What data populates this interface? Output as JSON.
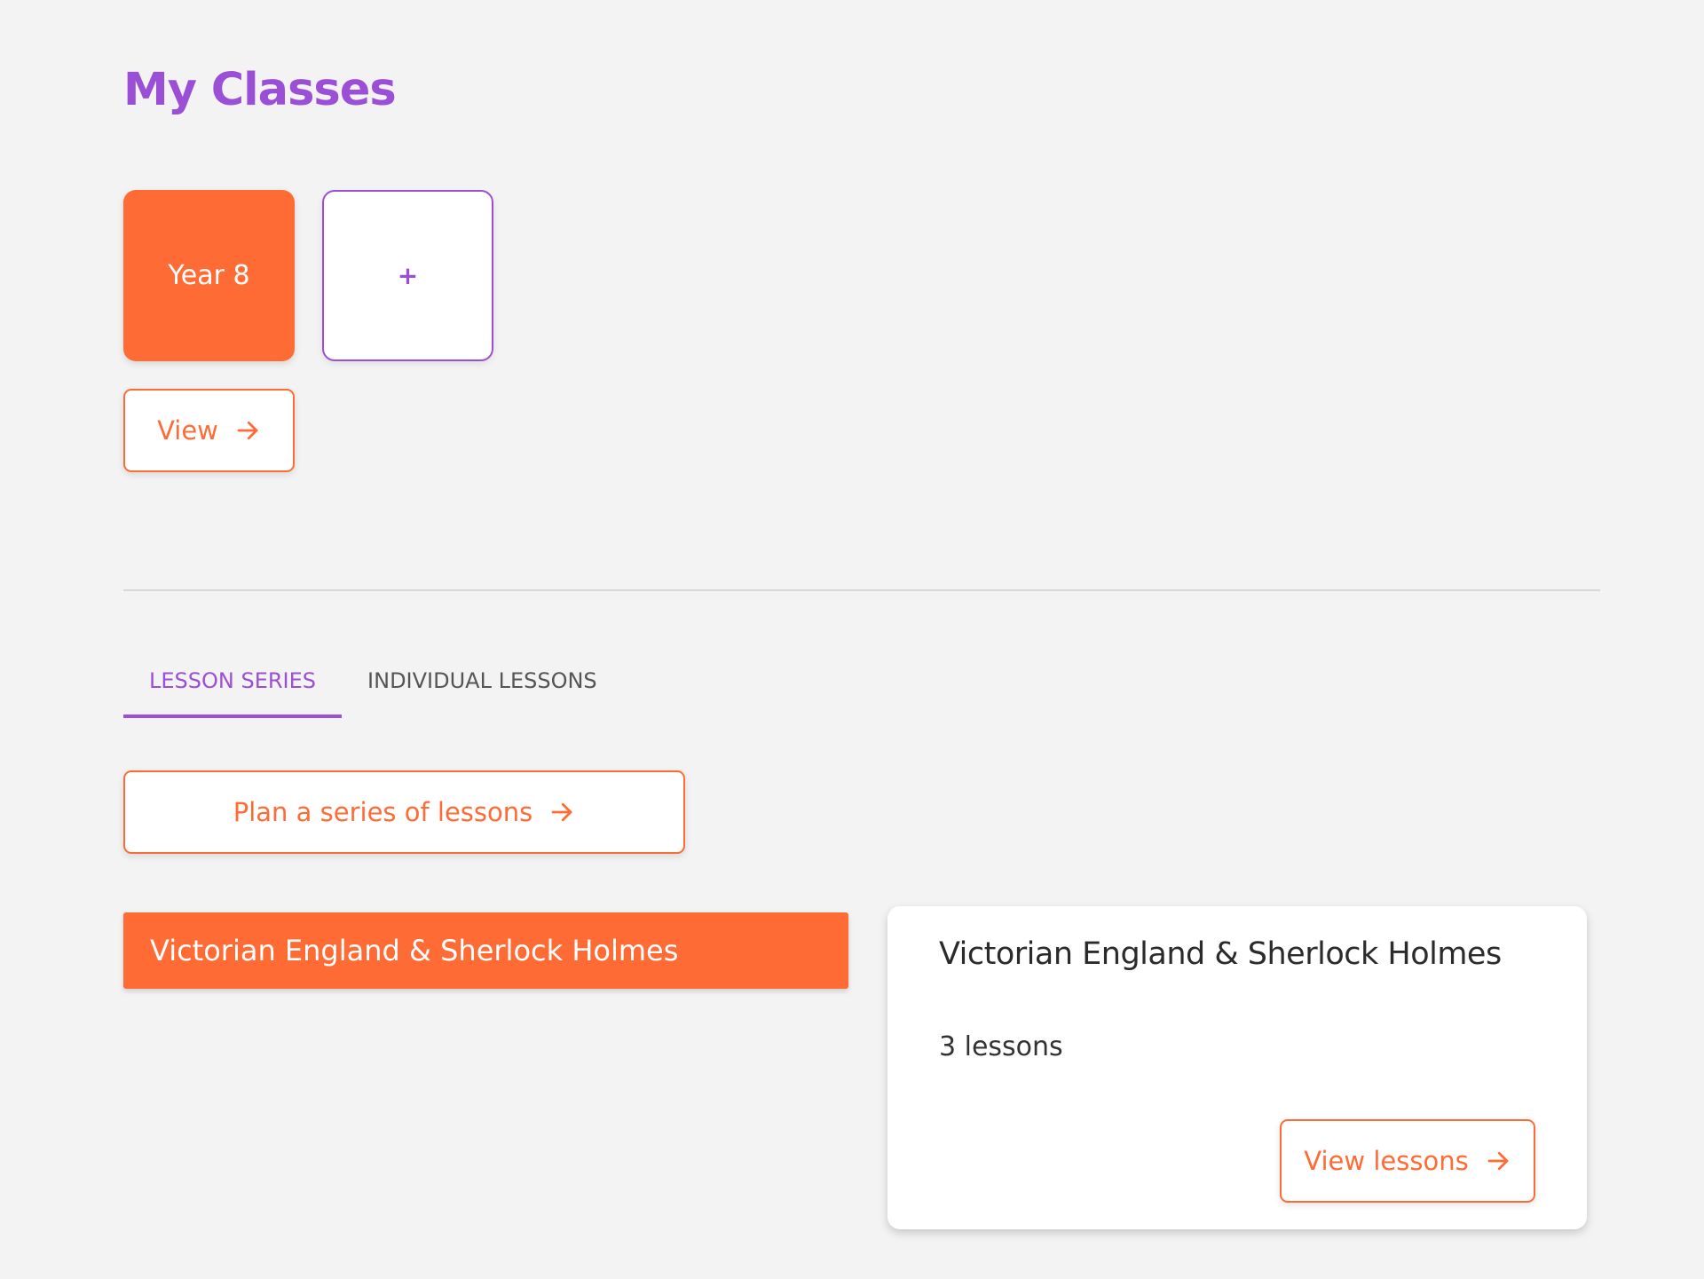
{
  "header": {
    "title": "My Classes"
  },
  "classes": {
    "items": [
      {
        "label": "Year 8"
      }
    ],
    "add_label": "+",
    "view_label": "View"
  },
  "tabs": [
    {
      "label": "Lesson Series",
      "active": true
    },
    {
      "label": "Individual Lessons",
      "active": false
    }
  ],
  "series": {
    "plan_label": "Plan a series of lessons",
    "list": [
      {
        "title": "Victorian England & Sherlock Holmes"
      }
    ],
    "selected": {
      "title": "Victorian England & Sherlock Holmes",
      "count_text": "3 lessons",
      "action_label": "View lessons"
    }
  },
  "icons": {
    "arrow": "arrow-right-icon"
  },
  "colors": {
    "primary_purple": "#9b4fd6",
    "accent_orange": "#ff6b35",
    "background": "#f3f3f3"
  }
}
